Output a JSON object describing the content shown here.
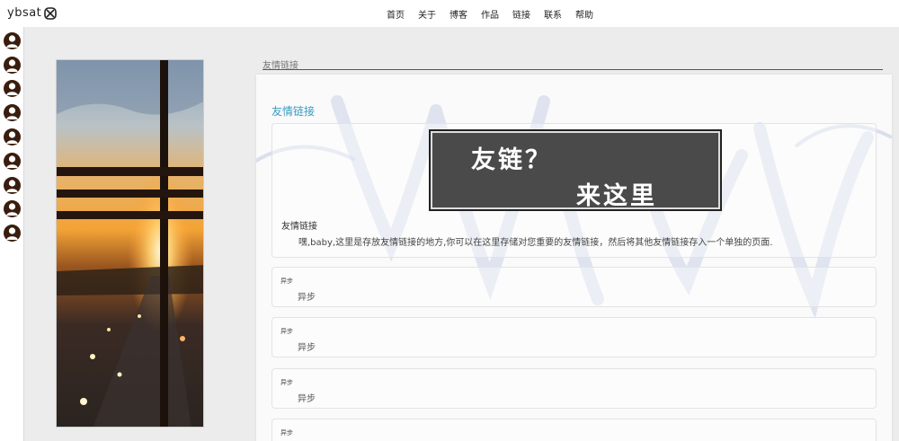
{
  "brand": {
    "name": "ybsat"
  },
  "nav": {
    "items": [
      {
        "label": "首页"
      },
      {
        "label": "关于"
      },
      {
        "label": "博客"
      },
      {
        "label": "作品"
      },
      {
        "label": "链接"
      },
      {
        "label": "联系"
      },
      {
        "label": "帮助"
      }
    ]
  },
  "sidebar": {
    "avatar_count": 9,
    "avatar_icon": "user-avatar-icon"
  },
  "page": {
    "section_heading": "友情链接"
  },
  "card": {
    "title": "友情链接",
    "title_color": "#3a9bc2",
    "banner": {
      "line1": "友链？",
      "line2": "来这里"
    },
    "intro_label": "友情链接",
    "intro_text": "嘿,baby,这里是存放友情链接的地方,你可以在这里存储对您重要的友情链接，然后将其他友情链接存入一个单独的页面."
  },
  "links": [
    {
      "name": "异步",
      "desc": "异步"
    },
    {
      "name": "异步",
      "desc": "异步"
    },
    {
      "name": "异步",
      "desc": "异步"
    },
    {
      "name": "异步",
      "desc": ""
    }
  ]
}
